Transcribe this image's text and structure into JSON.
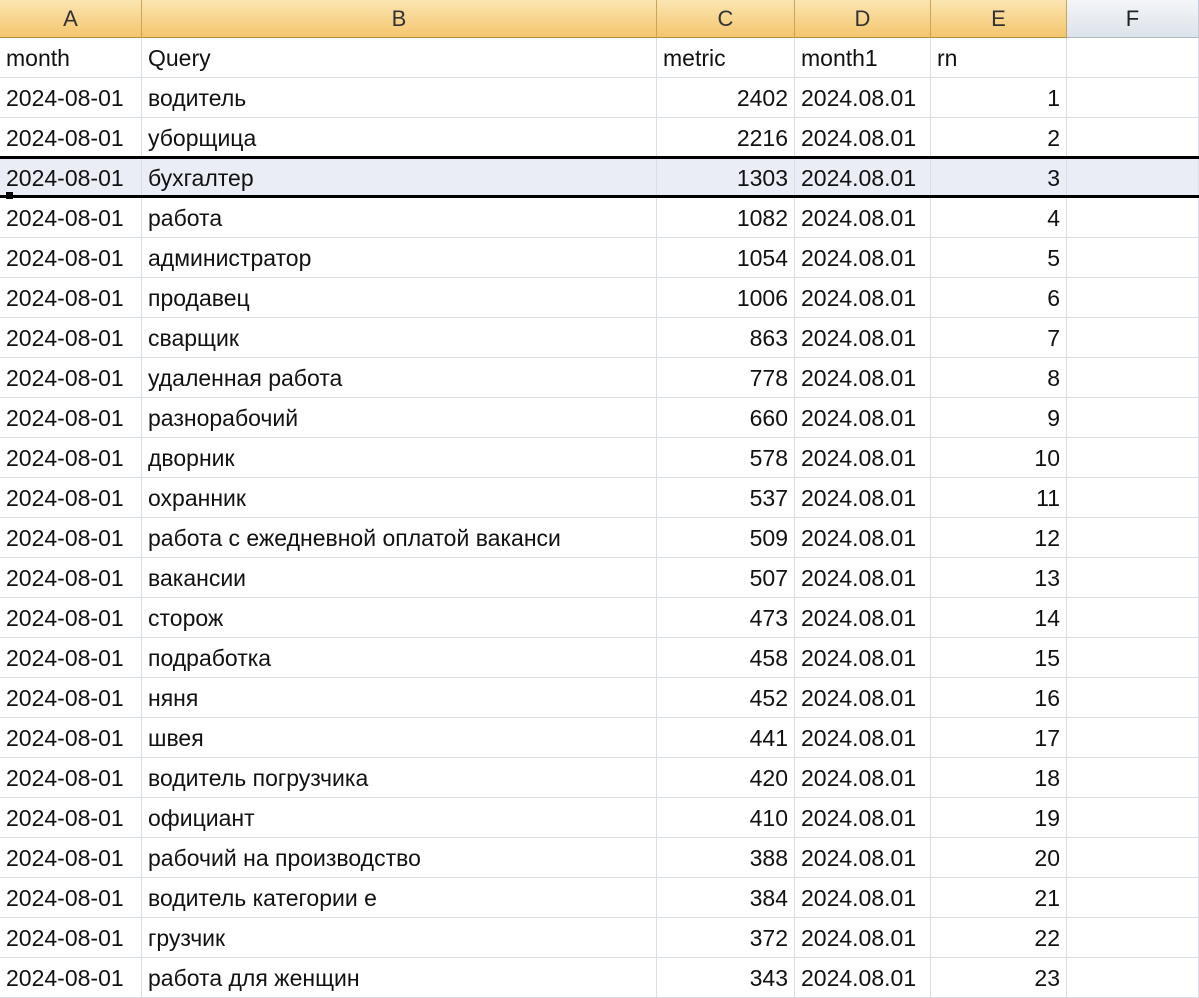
{
  "columns": [
    "A",
    "B",
    "C",
    "D",
    "E",
    "F"
  ],
  "headers": {
    "a": "month",
    "b": "Query",
    "c": "metric",
    "d": "month1",
    "e": "rn",
    "f": ""
  },
  "rows": [
    {
      "a": "2024-08-01",
      "b": "водитель",
      "c": "2402",
      "d": "2024.08.01",
      "e": "1"
    },
    {
      "a": "2024-08-01",
      "b": "уборщица",
      "c": "2216",
      "d": "2024.08.01",
      "e": "2"
    },
    {
      "a": "2024-08-01",
      "b": "бухгалтер",
      "c": "1303",
      "d": "2024.08.01",
      "e": "3"
    },
    {
      "a": "2024-08-01",
      "b": "работа",
      "c": "1082",
      "d": "2024.08.01",
      "e": "4"
    },
    {
      "a": "2024-08-01",
      "b": "администратор",
      "c": "1054",
      "d": "2024.08.01",
      "e": "5"
    },
    {
      "a": "2024-08-01",
      "b": "продавец",
      "c": "1006",
      "d": "2024.08.01",
      "e": "6"
    },
    {
      "a": "2024-08-01",
      "b": "сварщик",
      "c": "863",
      "d": "2024.08.01",
      "e": "7"
    },
    {
      "a": "2024-08-01",
      "b": "удаленная работа",
      "c": "778",
      "d": "2024.08.01",
      "e": "8"
    },
    {
      "a": "2024-08-01",
      "b": "разнорабочий",
      "c": "660",
      "d": "2024.08.01",
      "e": "9"
    },
    {
      "a": "2024-08-01",
      "b": "дворник",
      "c": "578",
      "d": "2024.08.01",
      "e": "10"
    },
    {
      "a": "2024-08-01",
      "b": "охранник",
      "c": "537",
      "d": "2024.08.01",
      "e": "11"
    },
    {
      "a": "2024-08-01",
      "b": "работа с ежедневной оплатой ваканси",
      "c": "509",
      "d": "2024.08.01",
      "e": "12"
    },
    {
      "a": "2024-08-01",
      "b": "вакансии",
      "c": "507",
      "d": "2024.08.01",
      "e": "13"
    },
    {
      "a": "2024-08-01",
      "b": "сторож",
      "c": "473",
      "d": "2024.08.01",
      "e": "14"
    },
    {
      "a": "2024-08-01",
      "b": "подработка",
      "c": "458",
      "d": "2024.08.01",
      "e": "15"
    },
    {
      "a": "2024-08-01",
      "b": "няня",
      "c": "452",
      "d": "2024.08.01",
      "e": "16"
    },
    {
      "a": "2024-08-01",
      "b": "швея",
      "c": "441",
      "d": "2024.08.01",
      "e": "17"
    },
    {
      "a": "2024-08-01",
      "b": "водитель погрузчика",
      "c": "420",
      "d": "2024.08.01",
      "e": "18"
    },
    {
      "a": "2024-08-01",
      "b": "официант",
      "c": "410",
      "d": "2024.08.01",
      "e": "19"
    },
    {
      "a": "2024-08-01",
      "b": "рабочий на производство",
      "c": "388",
      "d": "2024.08.01",
      "e": "20"
    },
    {
      "a": "2024-08-01",
      "b": "водитель категории е",
      "c": "384",
      "d": "2024.08.01",
      "e": "21"
    },
    {
      "a": "2024-08-01",
      "b": "грузчик",
      "c": "372",
      "d": "2024.08.01",
      "e": "22"
    },
    {
      "a": "2024-08-01",
      "b": "работа для женщин",
      "c": "343",
      "d": "2024.08.01",
      "e": "23"
    }
  ],
  "selected_row": 3
}
